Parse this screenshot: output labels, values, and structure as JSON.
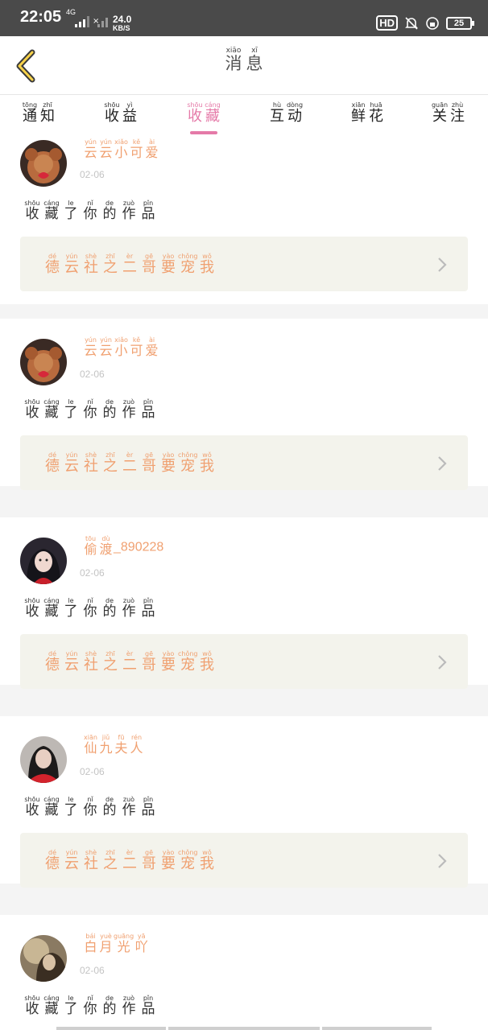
{
  "status_bar": {
    "time": "22:05",
    "network": "4G",
    "speed_value": "24.0",
    "speed_unit": "KB/S",
    "hd": "HD",
    "battery": "25"
  },
  "header": {
    "title": [
      {
        "char": "消",
        "pinyin": "xiāo"
      },
      {
        "char": "息",
        "pinyin": "xī"
      }
    ]
  },
  "tabs": [
    {
      "chars": [
        {
          "char": "通",
          "pinyin": "tōng"
        },
        {
          "char": "知",
          "pinyin": "zhī"
        }
      ],
      "active": false
    },
    {
      "chars": [
        {
          "char": "收",
          "pinyin": "shōu"
        },
        {
          "char": "益",
          "pinyin": "yì"
        }
      ],
      "active": false
    },
    {
      "chars": [
        {
          "char": "收",
          "pinyin": "shōu"
        },
        {
          "char": "藏",
          "pinyin": "cáng"
        }
      ],
      "active": true
    },
    {
      "chars": [
        {
          "char": "互",
          "pinyin": "hù"
        },
        {
          "char": "动",
          "pinyin": "dòng"
        }
      ],
      "active": false
    },
    {
      "chars": [
        {
          "char": "鲜",
          "pinyin": "xiān"
        },
        {
          "char": "花",
          "pinyin": "huā"
        }
      ],
      "active": false
    },
    {
      "chars": [
        {
          "char": "关",
          "pinyin": "guān"
        },
        {
          "char": "注",
          "pinyin": "zhù"
        }
      ],
      "active": false
    }
  ],
  "colors": {
    "accent_pink": "#e57aa8",
    "name_orange": "#f0a070",
    "card_box": "#f3f3ec"
  },
  "action_text": [
    {
      "char": "收",
      "pinyin": "shōu"
    },
    {
      "char": "藏",
      "pinyin": "cáng"
    },
    {
      "char": "了",
      "pinyin": "le"
    },
    {
      "char": "你",
      "pinyin": "nǐ"
    },
    {
      "char": "的",
      "pinyin": "de"
    },
    {
      "char": "作",
      "pinyin": "zuò"
    },
    {
      "char": "品",
      "pinyin": "pǐn"
    }
  ],
  "work_title": [
    {
      "char": "德",
      "pinyin": "dé"
    },
    {
      "char": "云",
      "pinyin": "yún"
    },
    {
      "char": "社",
      "pinyin": "shè"
    },
    {
      "char": "之",
      "pinyin": "zhī"
    },
    {
      "char": "二",
      "pinyin": "èr"
    },
    {
      "char": "哥",
      "pinyin": "gē"
    },
    {
      "char": "要",
      "pinyin": "yào"
    },
    {
      "char": "宠",
      "pinyin": "chǒng"
    },
    {
      "char": "我",
      "pinyin": "wǒ"
    }
  ],
  "notifications": [
    {
      "user": [
        {
          "char": "云",
          "pinyin": "yún"
        },
        {
          "char": "云",
          "pinyin": "yún"
        },
        {
          "char": "小",
          "pinyin": "xiǎo"
        },
        {
          "char": "可",
          "pinyin": "kě"
        },
        {
          "char": "爱",
          "pinyin": "ài"
        }
      ],
      "user_suffix": "",
      "date": "02-06",
      "avatar": "teddy-bear"
    },
    {
      "user": [
        {
          "char": "云",
          "pinyin": "yún"
        },
        {
          "char": "云",
          "pinyin": "yún"
        },
        {
          "char": "小",
          "pinyin": "xiǎo"
        },
        {
          "char": "可",
          "pinyin": "kě"
        },
        {
          "char": "爱",
          "pinyin": "ài"
        }
      ],
      "user_suffix": "",
      "date": "02-06",
      "avatar": "teddy-bear"
    },
    {
      "user": [
        {
          "char": "偷",
          "pinyin": "tōu"
        },
        {
          "char": "渡",
          "pinyin": "dù"
        }
      ],
      "user_suffix": "_890228",
      "date": "02-06",
      "avatar": "dark-hair-girl"
    },
    {
      "user": [
        {
          "char": "仙",
          "pinyin": "xiān"
        },
        {
          "char": "九",
          "pinyin": "jiǔ"
        },
        {
          "char": "夫",
          "pinyin": "fū"
        },
        {
          "char": "人",
          "pinyin": "rén"
        }
      ],
      "user_suffix": "",
      "date": "02-06",
      "avatar": "girl-red-scarf"
    },
    {
      "user": [
        {
          "char": "白",
          "pinyin": "bái"
        },
        {
          "char": "月",
          "pinyin": "yuè"
        },
        {
          "char": "光",
          "pinyin": "guāng"
        },
        {
          "char": "吖",
          "pinyin": "yā"
        }
      ],
      "user_suffix": "",
      "date": "02-06",
      "avatar": "sepia-portrait"
    }
  ]
}
